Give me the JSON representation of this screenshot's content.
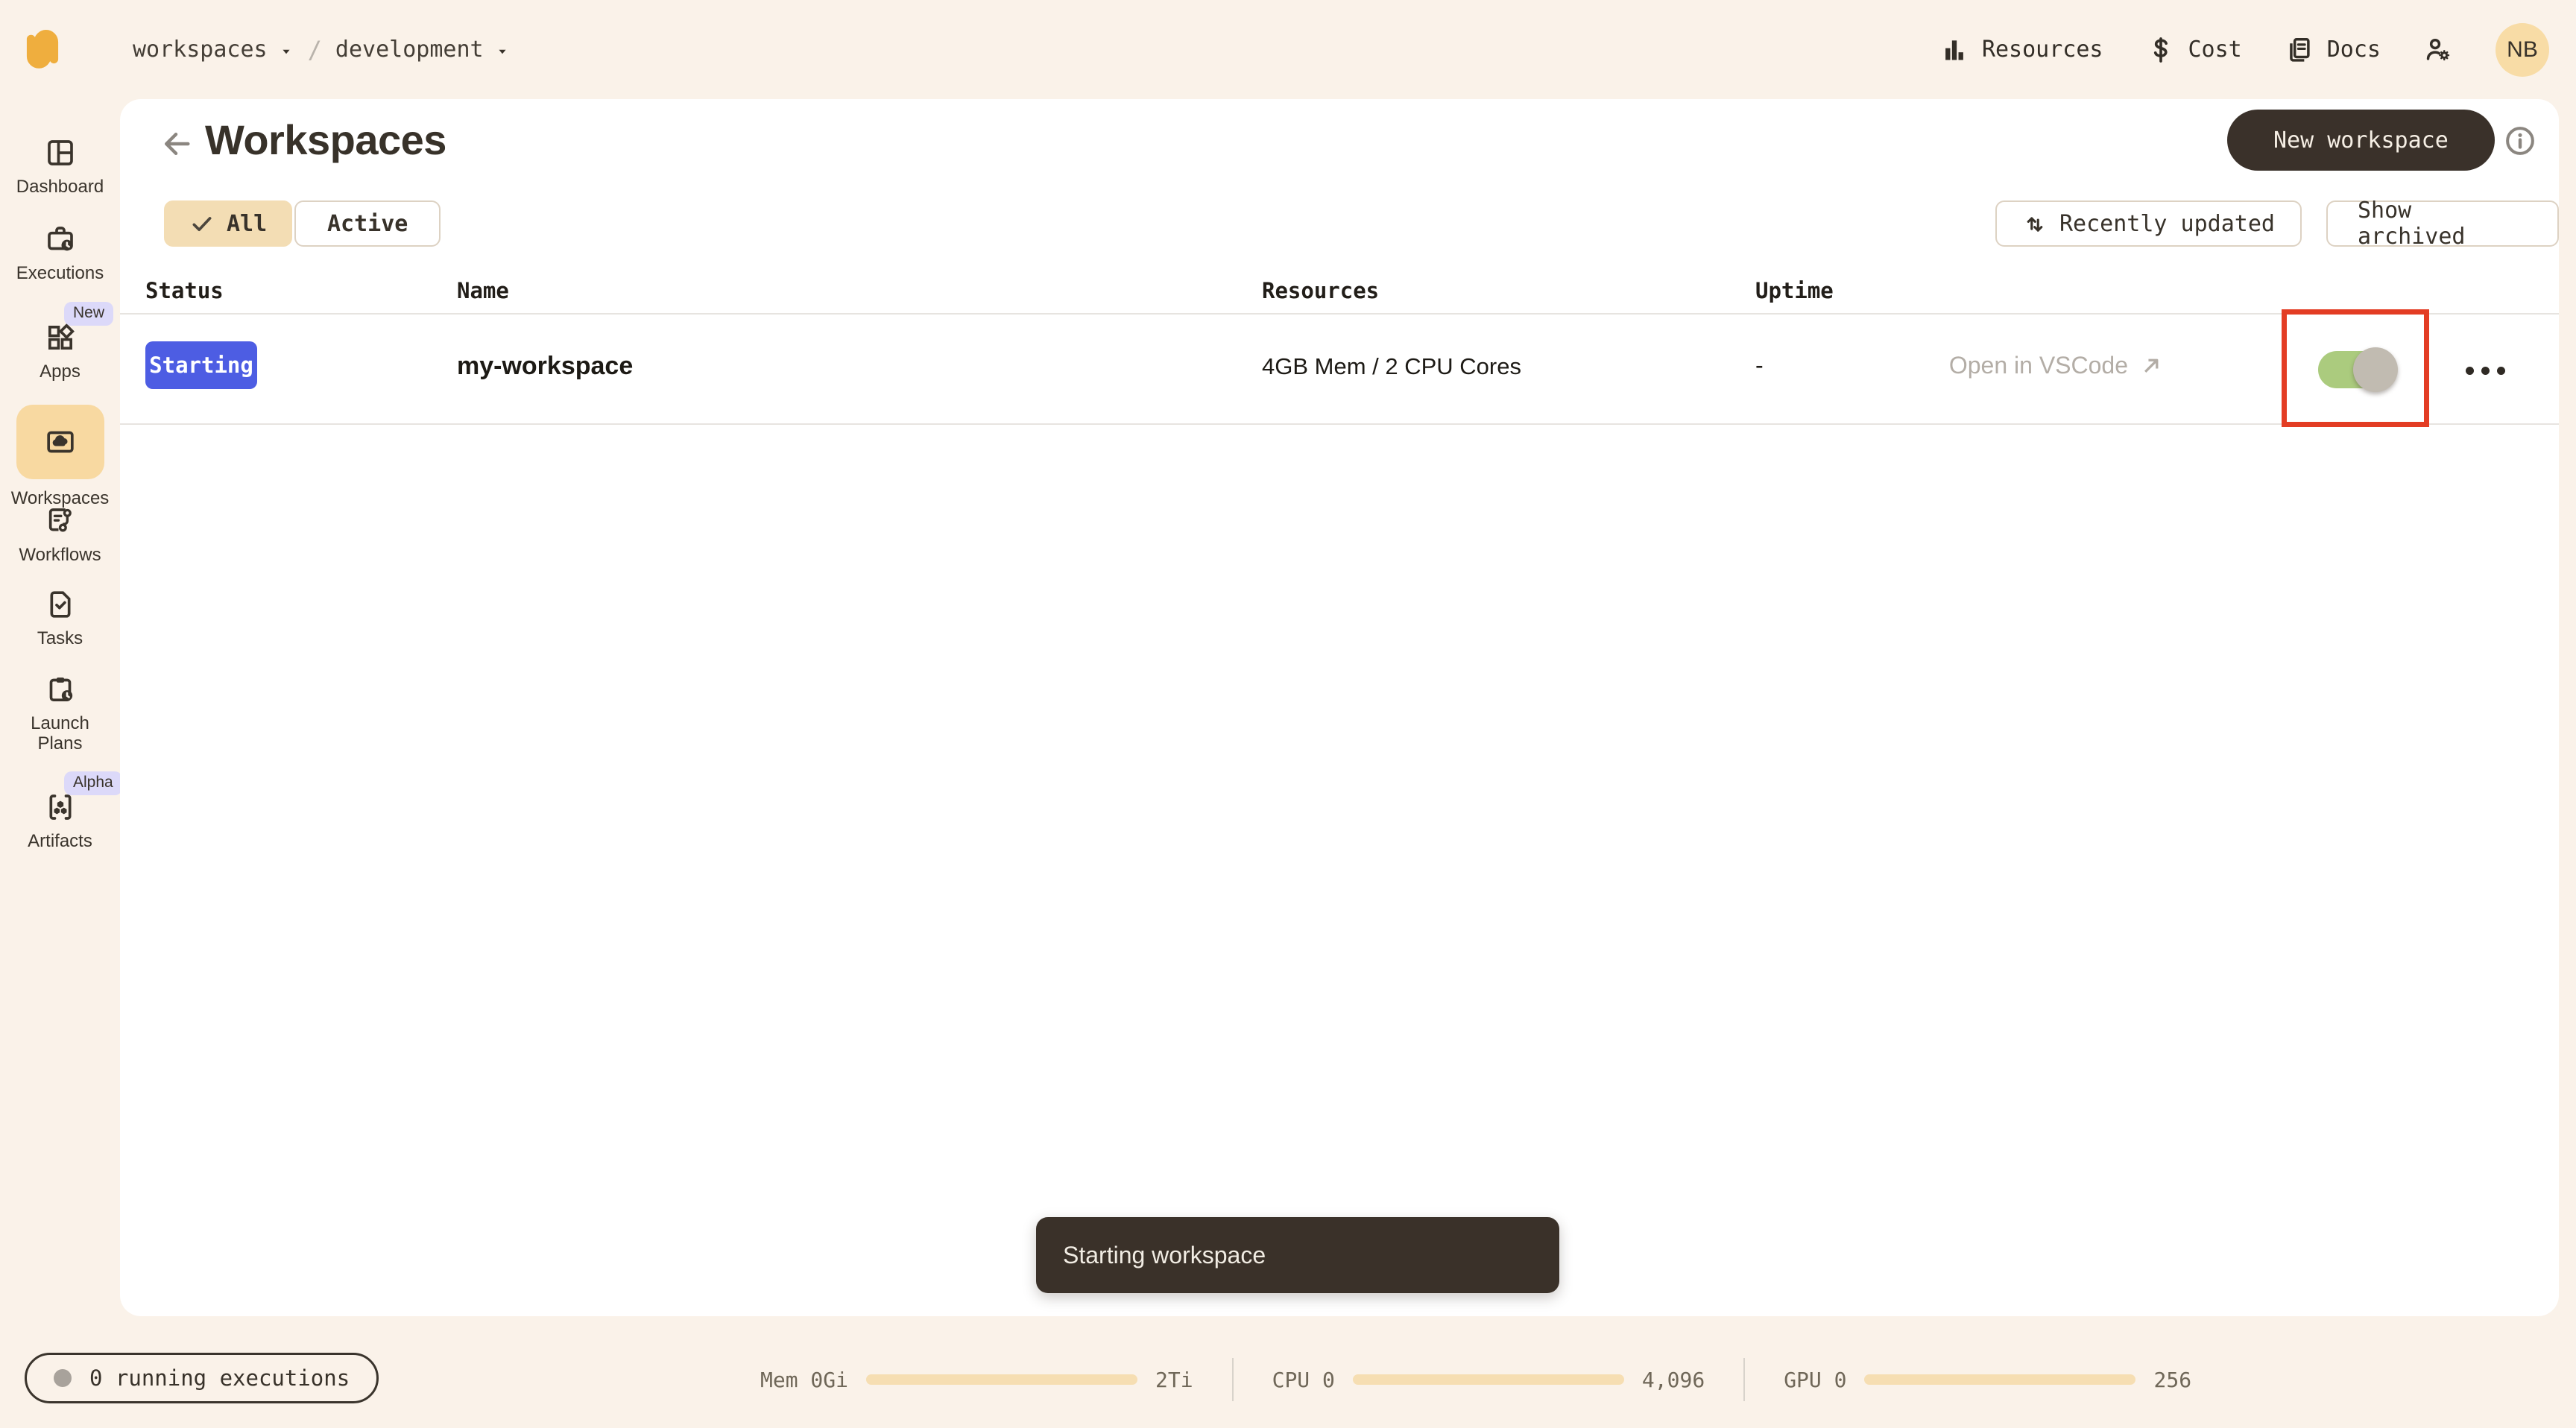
{
  "topbar": {
    "breadcrumb": {
      "items": [
        {
          "label": "workspaces"
        },
        {
          "label": "development"
        }
      ],
      "separator": "/"
    },
    "nav": {
      "resources": "Resources",
      "cost": "Cost",
      "docs": "Docs"
    },
    "avatar_initials": "NB"
  },
  "sidebar": {
    "items": [
      {
        "label": "Dashboard",
        "icon": "dashboard-icon"
      },
      {
        "label": "Executions",
        "icon": "executions-icon"
      },
      {
        "label": "Apps",
        "icon": "apps-icon",
        "badge": "New"
      },
      {
        "label": "Workspaces",
        "icon": "workspaces-icon",
        "active": true
      },
      {
        "label": "Workflows",
        "icon": "workflows-icon"
      },
      {
        "label": "Tasks",
        "icon": "tasks-icon"
      },
      {
        "label": "Launch Plans",
        "icon": "launch-plans-icon"
      },
      {
        "label": "Artifacts",
        "icon": "artifacts-icon",
        "badge": "Alpha"
      }
    ]
  },
  "page": {
    "title": "Workspaces",
    "actions": {
      "new_workspace": "New workspace"
    },
    "filters": {
      "all": "All",
      "active": "Active",
      "sort": "Recently updated",
      "archived": "Show archived"
    },
    "table": {
      "headers": {
        "status": "Status",
        "name": "Name",
        "resources": "Resources",
        "uptime": "Uptime"
      },
      "rows": [
        {
          "status": "Starting",
          "name": "my-workspace",
          "resources": "4GB Mem / 2 CPU Cores",
          "uptime": "-",
          "open_link": "Open in VSCode",
          "toggle_on": true
        }
      ]
    }
  },
  "toast": {
    "message": "Starting workspace"
  },
  "footer": {
    "executions_status": "0 running executions",
    "meters": [
      {
        "label": "Mem 0Gi",
        "max": "2Ti"
      },
      {
        "label": "CPU 0",
        "max": "4,096"
      },
      {
        "label": "GPU 0",
        "max": "256"
      }
    ]
  },
  "colors": {
    "background_cream": "#faf2e9",
    "card_white": "#ffffff",
    "brand_orange": "#efae3e",
    "selected_tan": "#f8d9a1",
    "chip_tan": "#f3ddb4",
    "badge_blue": "#4d5de3",
    "badge_lavender": "#dcd9f9",
    "toggle_green": "#abcb7e",
    "toggle_knob_gray": "#c1bbb1",
    "highlight_red": "#e33d24",
    "dark_button": "#3a312a",
    "meter_track": "#f6deb2"
  },
  "icons": {
    "top_nav": [
      "bar-chart-icon",
      "dollar-icon",
      "docs-icon",
      "user-gear-icon"
    ],
    "misc": [
      "back-arrow-icon",
      "info-icon",
      "check-icon",
      "sort-icon",
      "arrow-up-right-icon",
      "ellipsis-icon",
      "caret-down-icon"
    ]
  }
}
